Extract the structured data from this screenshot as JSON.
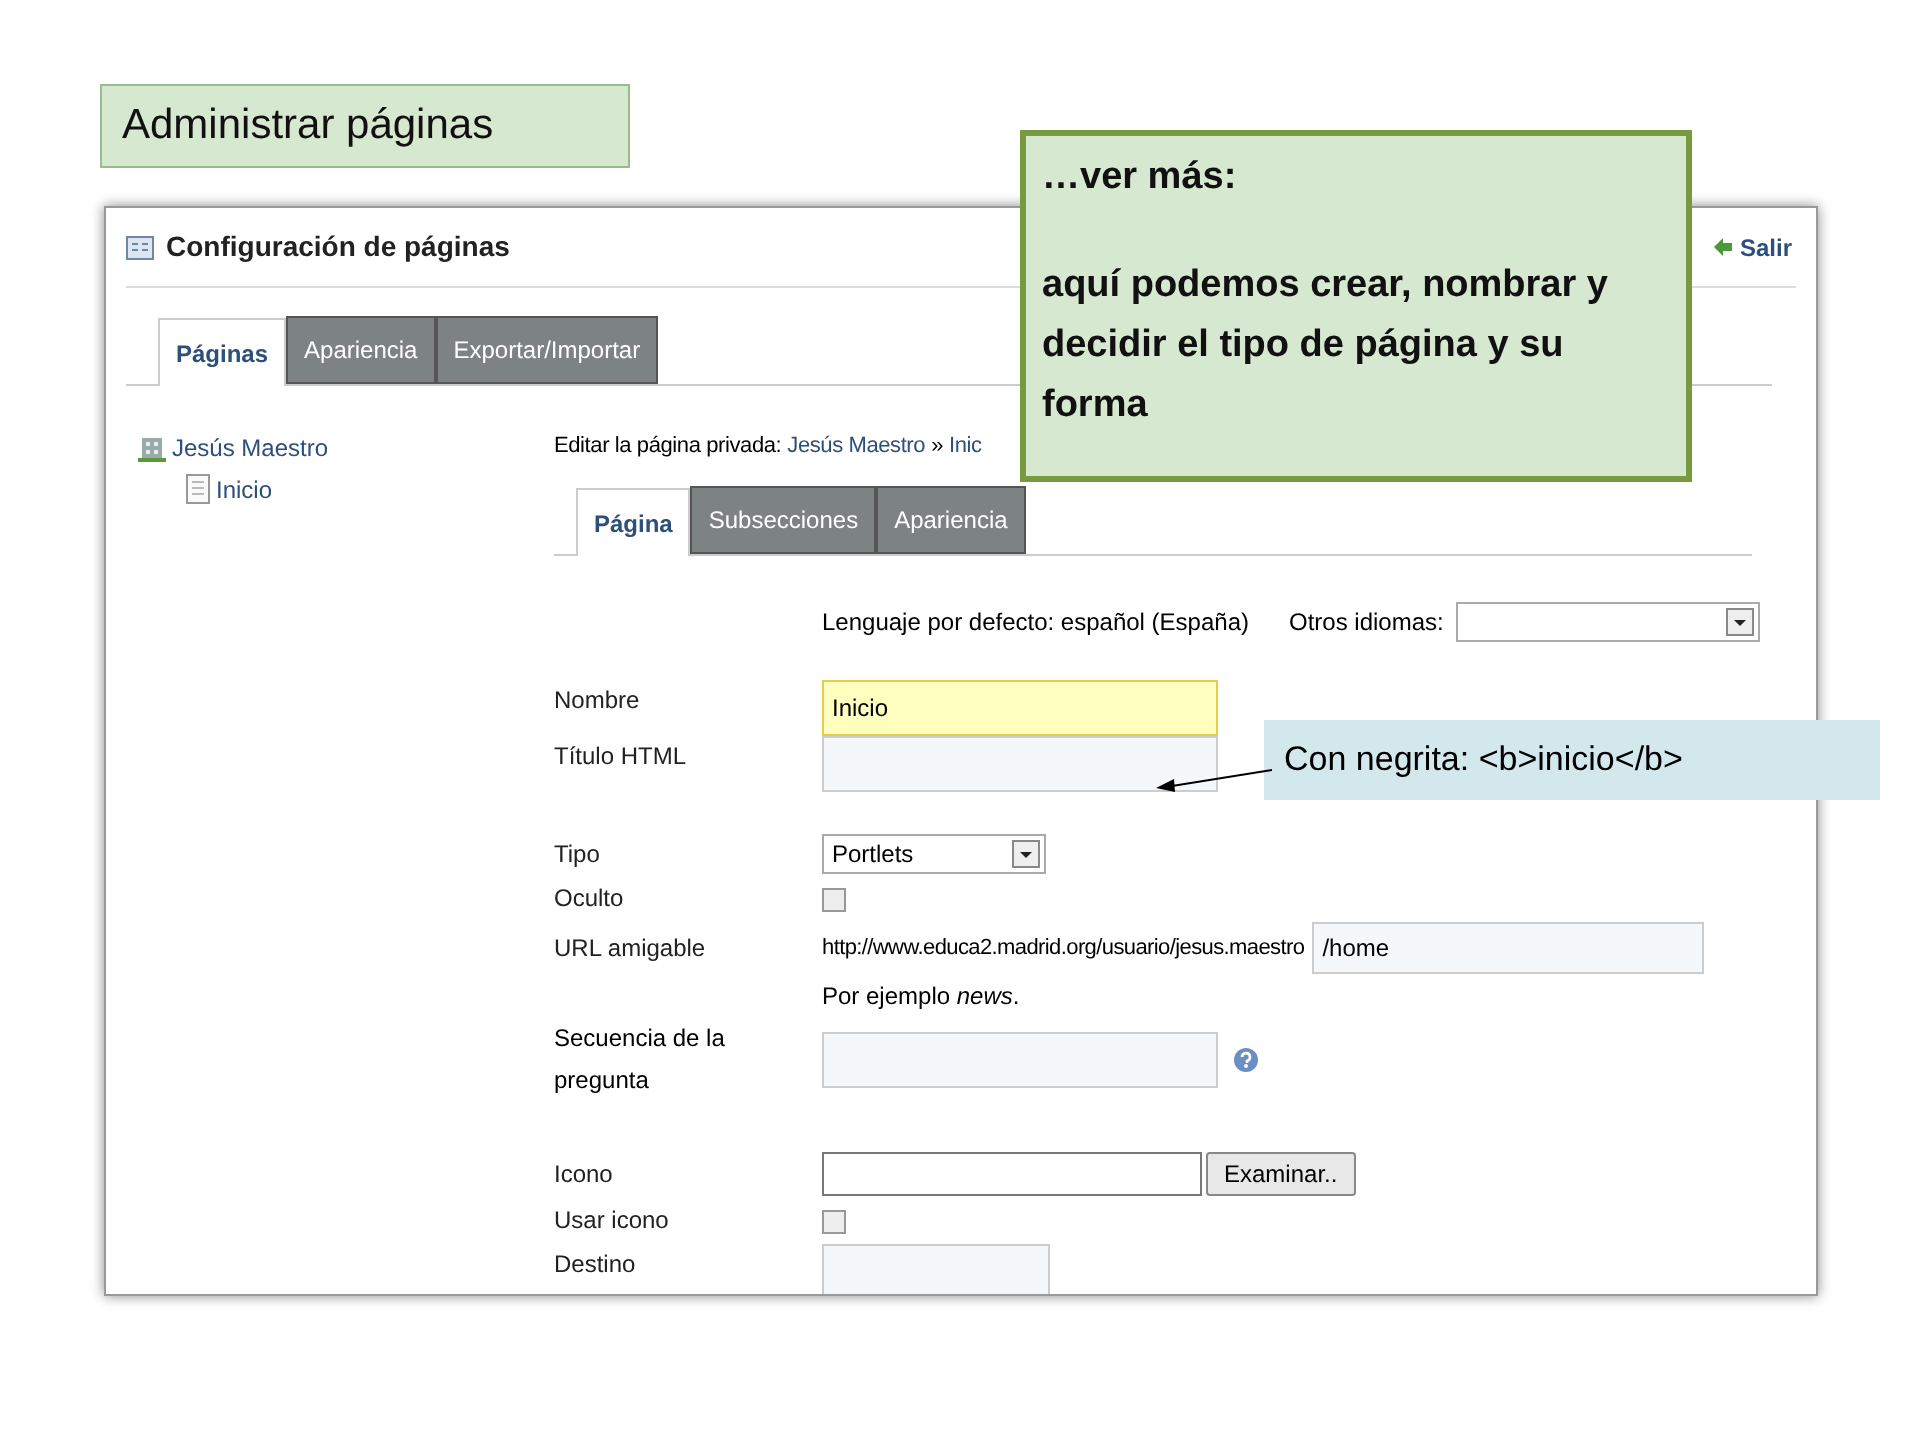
{
  "slide_title": "Administrar páginas",
  "panel": {
    "title": "Configuración de páginas",
    "exit_link": "Salir",
    "tabs": [
      {
        "label": "Páginas",
        "selected": true
      },
      {
        "label": "Apariencia",
        "selected": false
      },
      {
        "label": "Exportar/Importar",
        "selected": false
      }
    ],
    "tree": [
      {
        "label": "Jesús Maestro",
        "kind": "site",
        "children": [
          {
            "label": "Inicio",
            "kind": "page"
          }
        ]
      }
    ],
    "breadcrumb": {
      "prefix": "Editar la página privada:",
      "site": "Jesús Maestro",
      "separator": "»",
      "page": "Inic"
    },
    "inner_tabs": [
      {
        "label": "Página",
        "selected": true
      },
      {
        "label": "Subsecciones",
        "selected": false
      },
      {
        "label": "Apariencia",
        "selected": false
      }
    ],
    "default_language": "Lenguaje por defecto: español (España)",
    "other_languages_label": "Otros idiomas:",
    "form": [
      {
        "kind": "text",
        "label": "Nombre",
        "value": "Inicio",
        "highlighted": true
      },
      {
        "kind": "text",
        "label": "Título HTML",
        "highlighted": false
      },
      {
        "kind": "gap"
      },
      {
        "kind": "select",
        "label": "Tipo",
        "value": "Portlets"
      },
      {
        "kind": "checkbox",
        "label": "Oculto",
        "checked": false
      },
      {
        "kind": "url",
        "label": "URL amigable",
        "prefix": "http://www.educa2.madrid.org/usuario/jesus.maestro",
        "value": "/home"
      },
      {
        "kind": "hint",
        "text": "Por ejemplo *news*."
      },
      {
        "kind": "help_text",
        "label": "Secuencia de la pregunta"
      },
      {
        "kind": "gap"
      },
      {
        "kind": "file",
        "label": "Icono",
        "button": "Examinar.."
      },
      {
        "kind": "checkbox",
        "label": "Usar icono",
        "checked": false
      },
      {
        "kind": "short_text",
        "label": "Destino"
      }
    ]
  },
  "callouts": [
    {
      "heading": "…ver más:",
      "body": "aquí podemos crear, nombrar y decidir el tipo de página y su forma"
    },
    {
      "text": "Con negrita: <b>inicio</b>"
    }
  ]
}
